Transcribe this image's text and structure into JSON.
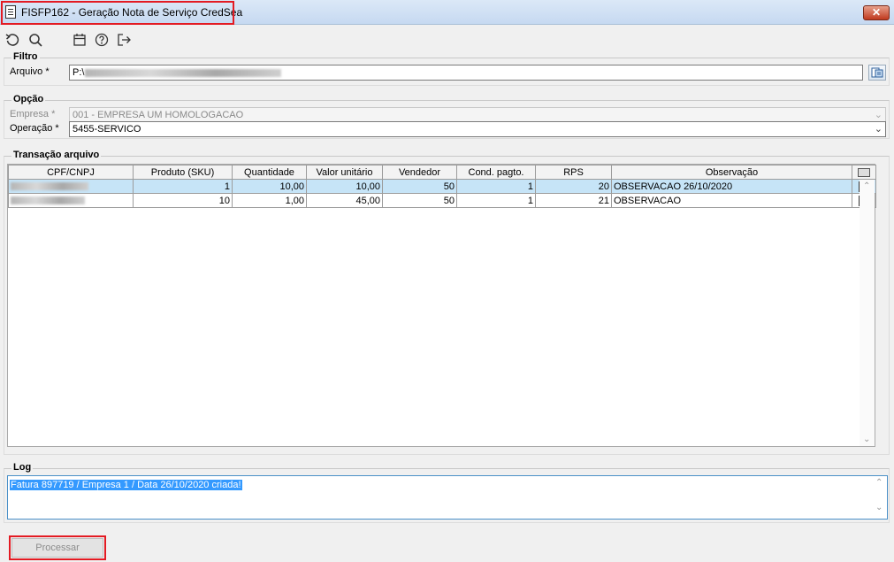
{
  "window": {
    "title": "FISFP162 - Geração Nota de Serviço CredSea",
    "close_label": "✕"
  },
  "toolbar": {
    "icons": [
      "undo-icon",
      "search-icon",
      "calendar-icon",
      "help-icon",
      "exit-icon"
    ]
  },
  "filtro": {
    "title": "Filtro",
    "arquivo_label": "Arquivo *",
    "arquivo_value": "P:\\"
  },
  "opcao": {
    "title": "Opção",
    "empresa_label": "Empresa *",
    "empresa_value": "001 - EMPRESA UM HOMOLOGACAO",
    "operacao_label": "Operação *",
    "operacao_value": "5455-SERVICO"
  },
  "transacao": {
    "title": "Transação arquivo",
    "columns": [
      "CPF/CNPJ",
      "Produto (SKU)",
      "Quantidade",
      "Valor unitário",
      "Vendedor",
      "Cond. pagto.",
      "RPS",
      "Observação"
    ],
    "rows": [
      {
        "produto": "1",
        "quantidade": "10,00",
        "valor": "10,00",
        "vendedor": "50",
        "cond": "1",
        "rps": "20",
        "obs": "OBSERVACAO 26/10/2020",
        "checked": true,
        "selected": true
      },
      {
        "produto": "10",
        "quantidade": "1,00",
        "valor": "45,00",
        "vendedor": "50",
        "cond": "1",
        "rps": "21",
        "obs": "OBSERVACAO",
        "checked": true,
        "selected": false
      }
    ]
  },
  "log": {
    "title": "Log",
    "message": "Fatura 897719 / Empresa 1 / Data 26/10/2020 criada!"
  },
  "actions": {
    "process_label": "Processar"
  },
  "colors": {
    "highlight": "#e31b23",
    "selection": "#c6e4f7",
    "log_selection": "#3399ff"
  }
}
